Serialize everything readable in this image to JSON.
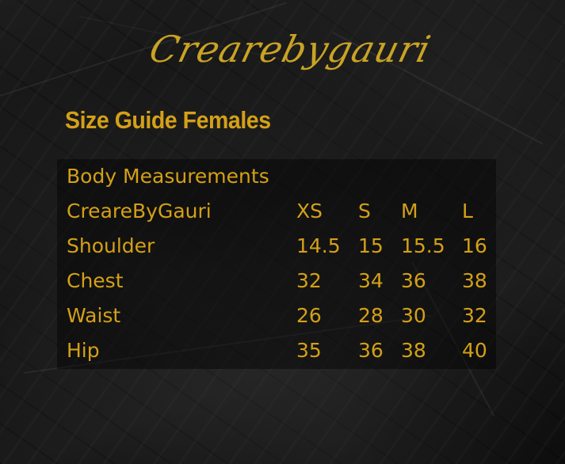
{
  "brand": {
    "logo_text": "CreareByGauri"
  },
  "title": "Size Guide Females",
  "table": {
    "section_label": "Body Measurements",
    "header": [
      "CreareByGauri",
      "XS",
      "S",
      "M",
      "L"
    ],
    "rows": [
      [
        "Shoulder",
        "14.5",
        "15",
        "15.5",
        "16"
      ],
      [
        "Chest",
        "32",
        "34",
        "36",
        "38"
      ],
      [
        "Waist",
        "26",
        "28",
        "30",
        "32"
      ],
      [
        "Hip",
        "35",
        "36",
        "38",
        "40"
      ]
    ]
  },
  "colors": {
    "accent_gold": "#d4a017",
    "background": "#141414",
    "panel": "#0a0a0a"
  }
}
